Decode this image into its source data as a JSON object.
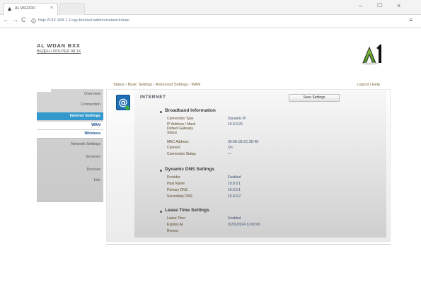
{
  "browser": {
    "tab_title": "AL WEDDD",
    "tab_close": "×",
    "new_tab_label": "",
    "url": "http://192.168.1.1/cgi-bin/luci/admin/network/wan",
    "win_min": "–",
    "win_max": "☐",
    "win_close": "×",
    "back": "←",
    "forward": "→",
    "reload": "C",
    "menu": "≡"
  },
  "site": {
    "title": "AL WDAN BXX",
    "subtitle": "ВЕДЕН | ROUTER 98.1X",
    "logo_text": "A1",
    "accent": "#3399cc"
  },
  "breadcrumb": "Status  ›  Basic Settings  ›  Advanced Settings  ›  WAN",
  "toplinks": "Logout  |  Help",
  "sidebar": {
    "items": [
      {
        "label": "Overview"
      },
      {
        "label": "Connection"
      },
      {
        "label": "Internet Settings"
      },
      {
        "label": "WAN"
      },
      {
        "label": "Wireless"
      },
      {
        "label": "Network Settings"
      },
      {
        "label": "Services"
      },
      {
        "label": "Devices"
      },
      {
        "label": "Info"
      }
    ]
  },
  "panel": {
    "title": "INTERNET",
    "button": "Save Settings",
    "sections": [
      {
        "heading": "Broadband Information",
        "rows": [
          {
            "label": "Connection Type",
            "value": "Dynamic IP"
          },
          {
            "label": "IP Address / Mask",
            "value": "10.0.0.25"
          },
          {
            "label": "Default Gateway",
            "value": ""
          },
          {
            "label": "Status",
            "value": ""
          },
          {
            "label": "MAC Address",
            "value": "00:0A:1B:2C:3D:4E"
          },
          {
            "label": "Connect",
            "value": "On"
          },
          {
            "label": "Connection Status",
            "value": "—"
          }
        ]
      },
      {
        "heading": "Dynamic DNS Settings",
        "rows": [
          {
            "label": "Provider",
            "value": "Enabled"
          },
          {
            "label": "Host Name",
            "value": "10.0.0.1"
          },
          {
            "label": "Primary DNS",
            "value": "10.0.0.1"
          },
          {
            "label": "Secondary DNS",
            "value": "10.0.0.2"
          }
        ]
      },
      {
        "heading": "Lease Time Settings",
        "rows": [
          {
            "label": "Lease Time",
            "value": "Enabled"
          },
          {
            "label": "Expires At",
            "value": "01/01/2024 12:00:00"
          },
          {
            "label": "Renew",
            "value": ""
          }
        ]
      }
    ]
  }
}
